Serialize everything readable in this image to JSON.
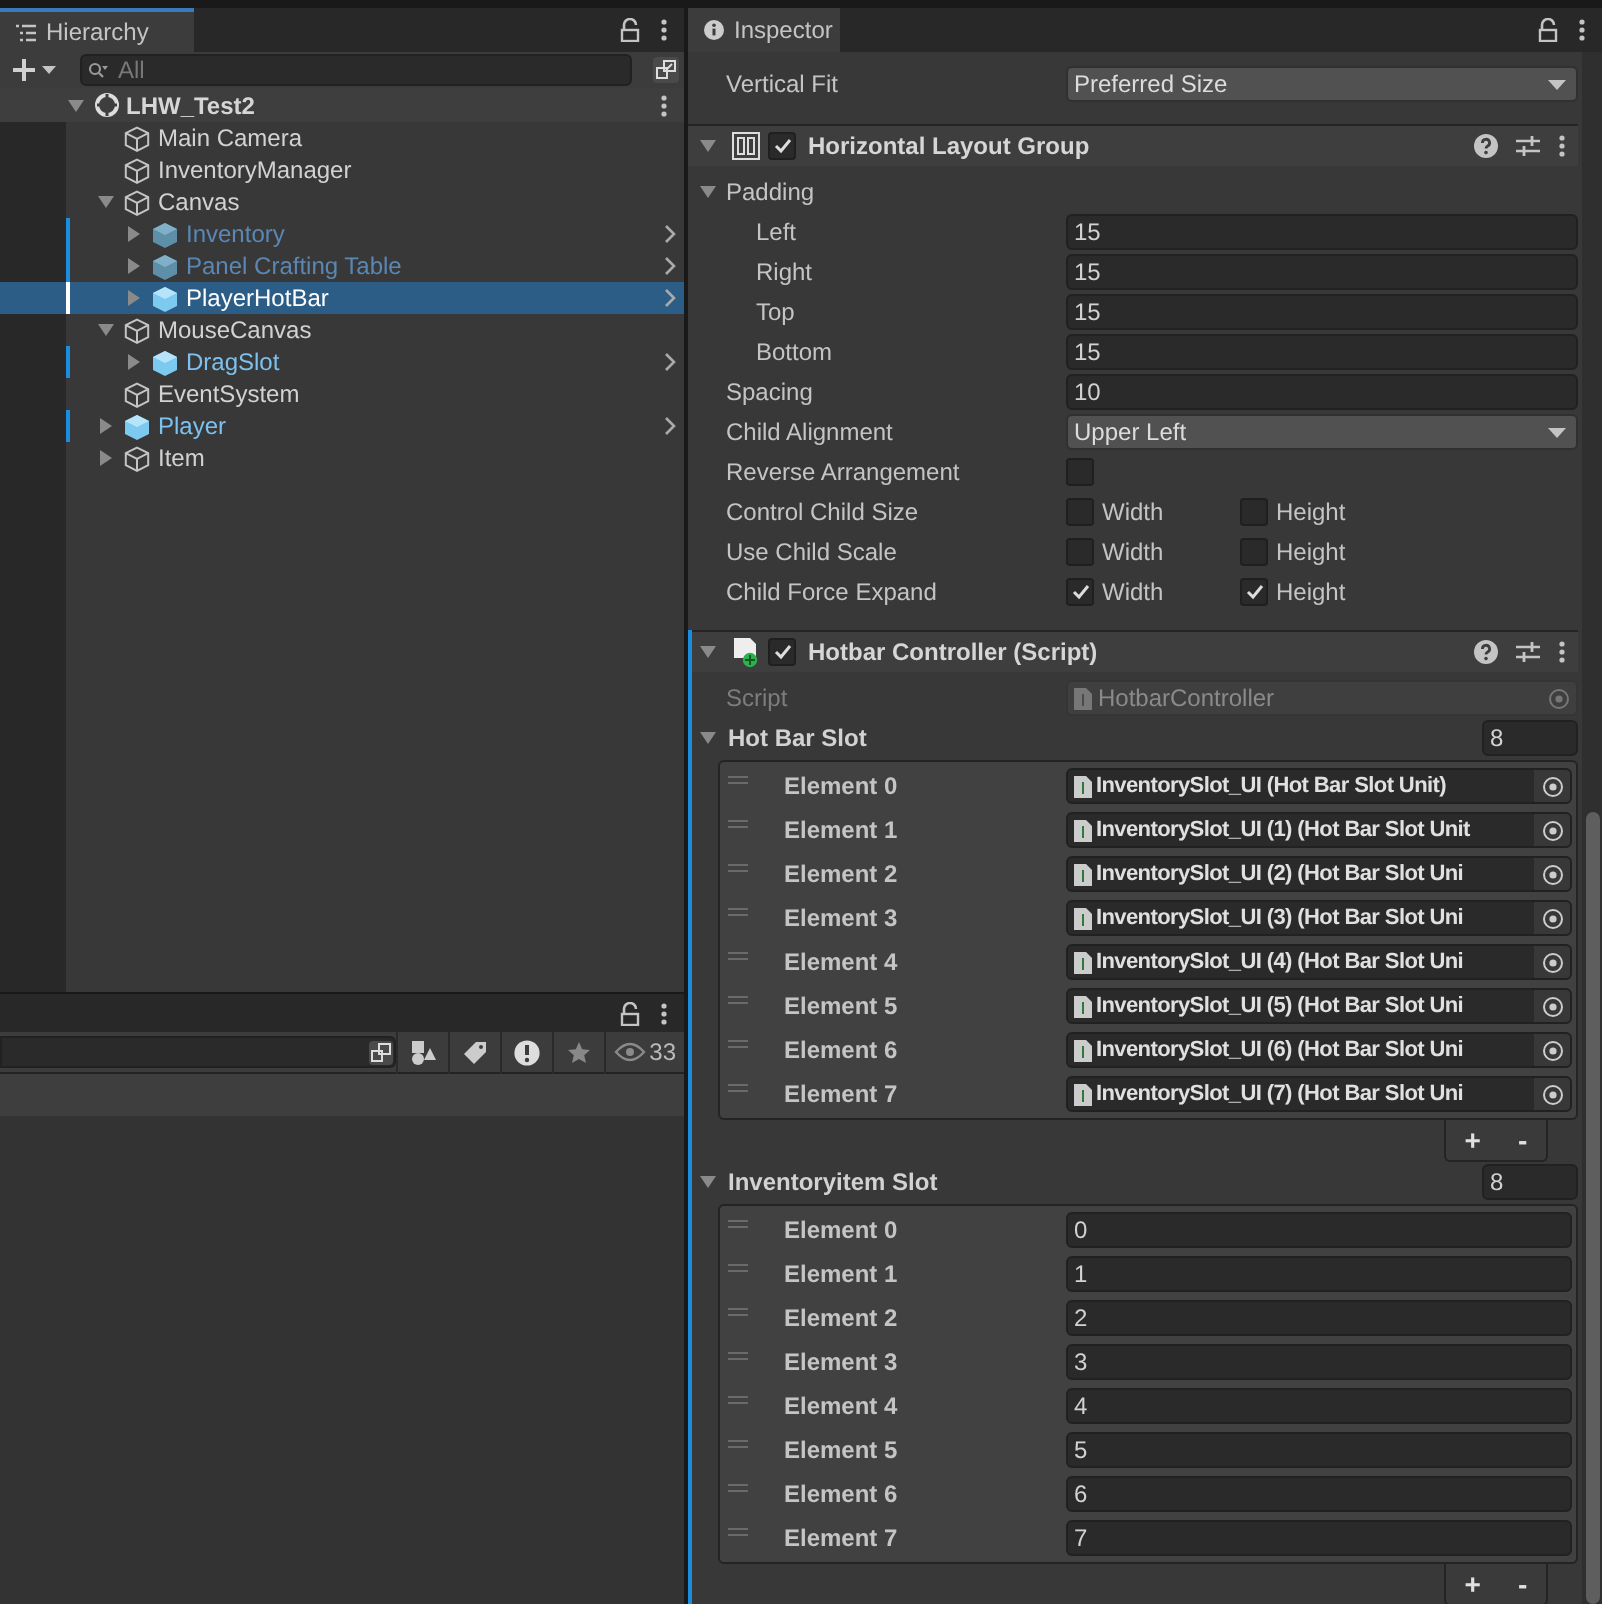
{
  "hierarchy": {
    "title": "Hierarchy",
    "search_placeholder": "All",
    "scene": {
      "name": "LHW_Test2",
      "expanded": true,
      "children": [
        {
          "name": "Main Camera",
          "kind": "object",
          "active": true,
          "selected": false,
          "expandable": false
        },
        {
          "name": "InventoryManager",
          "kind": "object",
          "active": true,
          "selected": false,
          "expandable": false
        },
        {
          "name": "Canvas",
          "kind": "object",
          "active": true,
          "selected": false,
          "expandable": true,
          "expanded": true,
          "children": [
            {
              "name": "Inventory",
              "kind": "prefab",
              "active": false,
              "selected": false,
              "expandable": true,
              "expanded": false
            },
            {
              "name": "Panel Crafting Table",
              "kind": "prefab",
              "active": false,
              "selected": false,
              "expandable": true,
              "expanded": false
            },
            {
              "name": "PlayerHotBar",
              "kind": "prefab",
              "active": true,
              "selected": true,
              "expandable": true,
              "expanded": false
            }
          ]
        },
        {
          "name": "MouseCanvas",
          "kind": "object",
          "active": true,
          "selected": false,
          "expandable": true,
          "expanded": true,
          "children": [
            {
              "name": "DragSlot",
              "kind": "prefab",
              "active": true,
              "selected": false,
              "expandable": true,
              "expanded": false
            }
          ]
        },
        {
          "name": "EventSystem",
          "kind": "object",
          "active": true,
          "selected": false,
          "expandable": false
        },
        {
          "name": "Player",
          "kind": "prefab",
          "active": true,
          "selected": false,
          "expandable": true,
          "expanded": false
        },
        {
          "name": "Item",
          "kind": "object",
          "active": true,
          "selected": false,
          "expandable": true,
          "expanded": false
        }
      ]
    }
  },
  "lower_panel": {
    "hidden_count": "33"
  },
  "inspector": {
    "title": "Inspector",
    "rows": [
      {
        "kind": "dropdown",
        "label": "Vertical Fit",
        "value": "Preferred Size"
      }
    ],
    "components": [
      {
        "title": "Horizontal Layout Group",
        "kind": "layout",
        "enabled": true,
        "modified": false,
        "rows": [
          {
            "kind": "foldout",
            "label": "Padding",
            "expanded": true,
            "children": [
              {
                "kind": "field",
                "label": "Left",
                "value": "15"
              },
              {
                "kind": "field",
                "label": "Right",
                "value": "15"
              },
              {
                "kind": "field",
                "label": "Top",
                "value": "15"
              },
              {
                "kind": "field",
                "label": "Bottom",
                "value": "15"
              }
            ]
          },
          {
            "kind": "field",
            "label": "Spacing",
            "value": "10"
          },
          {
            "kind": "dropdown",
            "label": "Child Alignment",
            "value": "Upper Left"
          },
          {
            "kind": "checkbox",
            "label": "Reverse Arrangement",
            "checked": false
          },
          {
            "kind": "pair",
            "label": "Control Child Size",
            "options": [
              {
                "label": "Width",
                "checked": false
              },
              {
                "label": "Height",
                "checked": false
              }
            ]
          },
          {
            "kind": "pair",
            "label": "Use Child Scale",
            "options": [
              {
                "label": "Width",
                "checked": false
              },
              {
                "label": "Height",
                "checked": false
              }
            ]
          },
          {
            "kind": "pair",
            "label": "Child Force Expand",
            "options": [
              {
                "label": "Width",
                "checked": true
              },
              {
                "label": "Height",
                "checked": true
              }
            ]
          }
        ]
      },
      {
        "title": "Hotbar Controller (Script)",
        "kind": "script",
        "enabled": true,
        "modified": true,
        "rows": [
          {
            "kind": "script",
            "label": "Script",
            "value": "HotbarController"
          },
          {
            "kind": "list",
            "label": "Hot Bar Slot",
            "size": "8",
            "expanded": true,
            "items": [
              {
                "kind": "object",
                "label": "Element 0",
                "value": "InventorySlot_UI (Hot Bar Slot Unit)"
              },
              {
                "kind": "object",
                "label": "Element 1",
                "value": "InventorySlot_UI (1) (Hot Bar Slot Unit"
              },
              {
                "kind": "object",
                "label": "Element 2",
                "value": "InventorySlot_UI (2) (Hot Bar Slot Uni"
              },
              {
                "kind": "object",
                "label": "Element 3",
                "value": "InventorySlot_UI (3) (Hot Bar Slot Uni"
              },
              {
                "kind": "object",
                "label": "Element 4",
                "value": "InventorySlot_UI (4) (Hot Bar Slot Uni"
              },
              {
                "kind": "object",
                "label": "Element 5",
                "value": "InventorySlot_UI (5) (Hot Bar Slot Uni"
              },
              {
                "kind": "object",
                "label": "Element 6",
                "value": "InventorySlot_UI (6) (Hot Bar Slot Uni"
              },
              {
                "kind": "object",
                "label": "Element 7",
                "value": "InventorySlot_UI (7) (Hot Bar Slot Uni"
              }
            ],
            "add": "+",
            "remove": "-"
          },
          {
            "kind": "list",
            "label": "Inventoryitem Slot",
            "size": "8",
            "expanded": true,
            "items": [
              {
                "kind": "int",
                "label": "Element 0",
                "value": "0"
              },
              {
                "kind": "int",
                "label": "Element 1",
                "value": "1"
              },
              {
                "kind": "int",
                "label": "Element 2",
                "value": "2"
              },
              {
                "kind": "int",
                "label": "Element 3",
                "value": "3"
              },
              {
                "kind": "int",
                "label": "Element 4",
                "value": "4"
              },
              {
                "kind": "int",
                "label": "Element 5",
                "value": "5"
              },
              {
                "kind": "int",
                "label": "Element 6",
                "value": "6"
              },
              {
                "kind": "int",
                "label": "Element 7",
                "value": "7"
              }
            ],
            "add": "+",
            "remove": "-"
          }
        ]
      }
    ]
  }
}
